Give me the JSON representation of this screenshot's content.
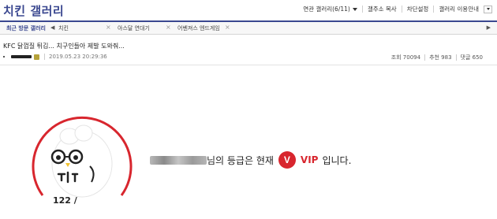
{
  "header": {
    "gallery_title": "치킨 갤러리",
    "related_gallery": "연관 갤러리(6/11)",
    "copy_gallery": "갤주소 복사",
    "block_settings": "차단설정",
    "gallery_info": "갤러리 이용안내"
  },
  "recent": {
    "label": "최근 방문 갤러리",
    "prev": "◀",
    "next": "▶",
    "close": "×",
    "items": [
      "치킨",
      "아스달 연대기",
      "어벤져스 엔드게임"
    ]
  },
  "post": {
    "title": "KFC 닭껍질 튀김... 치구인들아 제발 도와줘...",
    "datetime": "2019.05.23 20:29:36",
    "views": "조회 70094",
    "recommend": "추천 983",
    "comments": "댓글 650"
  },
  "grade": {
    "score": "122 /",
    "suffix": "님의 등급은 현재",
    "badge_letter": "V",
    "level": "VIP",
    "ending": "입니다."
  },
  "colors": {
    "brand": "#3b4890",
    "accent": "#d8262e"
  }
}
